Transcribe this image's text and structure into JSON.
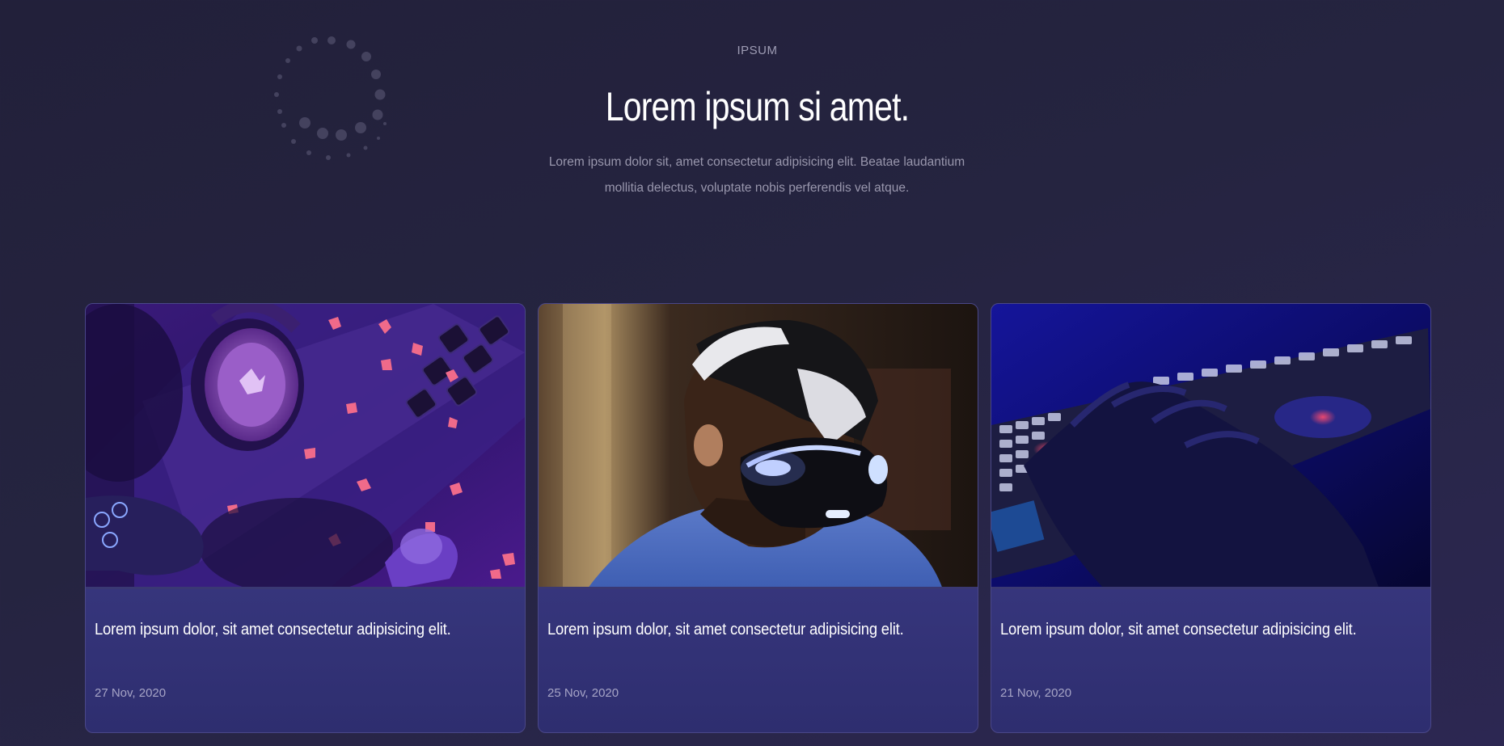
{
  "hero": {
    "eyebrow": "IPSUM",
    "title": "Lorem ipsum si amet.",
    "description": "Lorem ipsum dolor sit, amet consectetur adipisicing elit. Beatae laudantium mollitia delectus, voluptate nobis perferendis vel atque."
  },
  "cards": [
    {
      "image": "gaming-headset-controller-photo",
      "title": "Lorem ipsum dolor, sit amet consectetur adipisicing elit.",
      "date": "27 Nov, 2020"
    },
    {
      "image": "vr-headset-person-photo",
      "title": "Lorem ipsum dolor, sit amet consectetur adipisicing elit.",
      "date": "25 Nov, 2020"
    },
    {
      "image": "hand-on-keyboard-photo",
      "title": "Lorem ipsum dolor, sit amet consectetur adipisicing elit.",
      "date": "21 Nov, 2020"
    }
  ],
  "colors": {
    "background": "#23223a",
    "card_gradient_top": "#4b4a96",
    "card_gradient_bottom": "#2e2e6f",
    "muted_text": "#9997ad",
    "date_text": "#a6a4c6"
  }
}
